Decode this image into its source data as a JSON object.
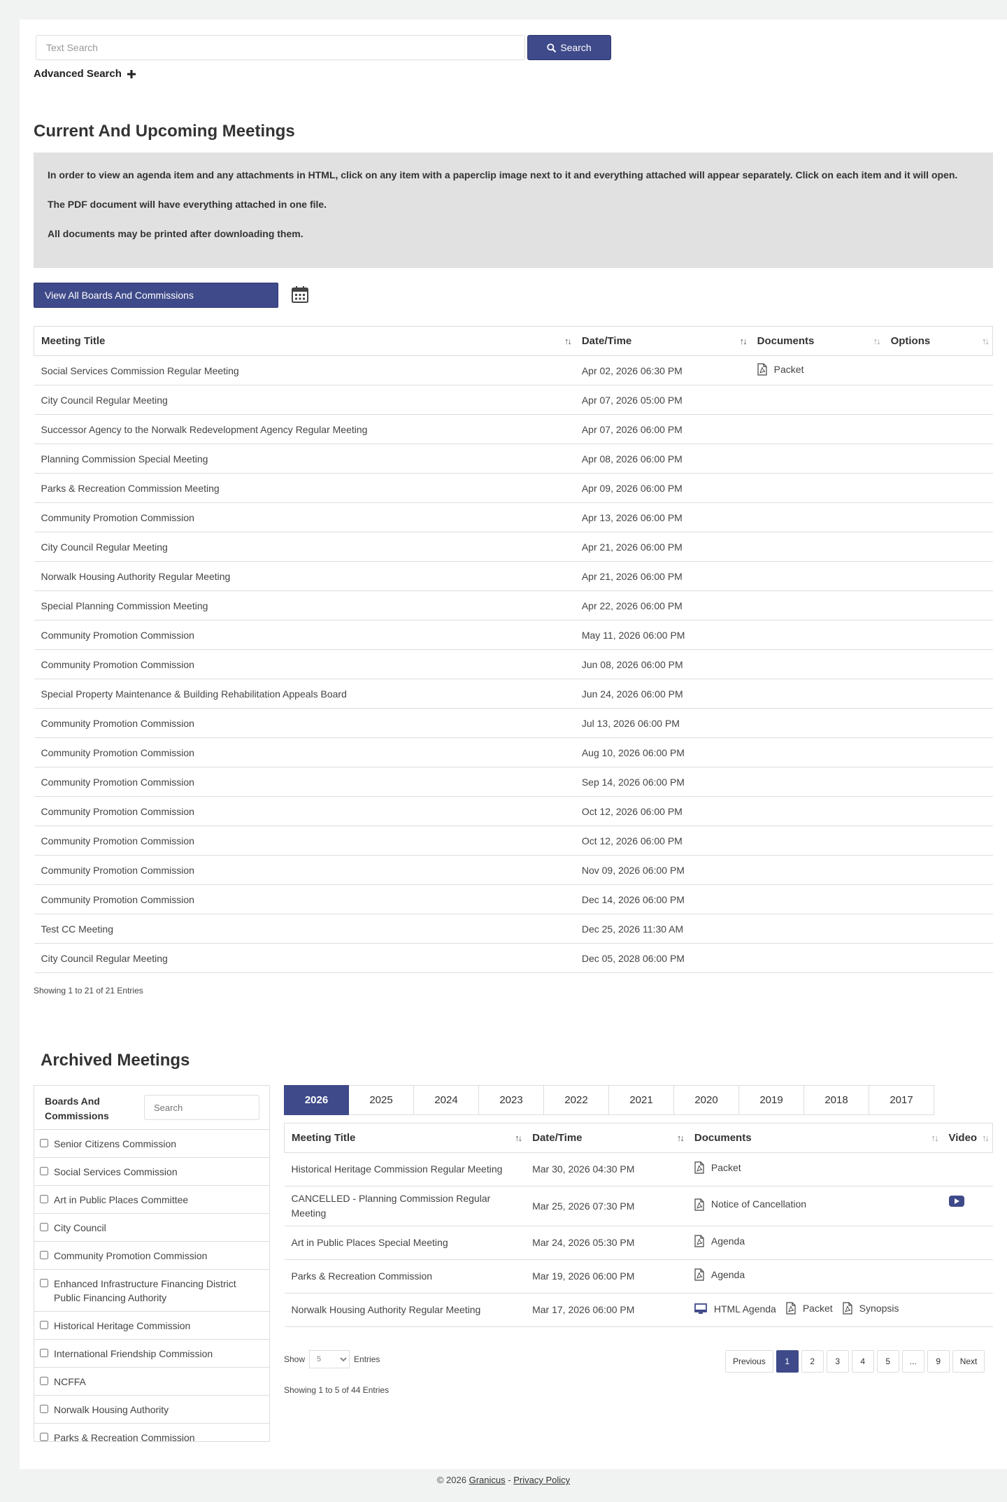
{
  "search": {
    "placeholder": "Text Search",
    "button_label": "Search"
  },
  "advanced_search_label": "Advanced Search",
  "upcoming": {
    "title": "Current And Upcoming Meetings",
    "notice": [
      "In order to view an agenda item and any attachments in HTML, click on any item with a paperclip image next to it and everything attached will appear separately.  Click on each item and it will open.",
      "The PDF document will have everything attached in one file.",
      "All documents may be printed after downloading them."
    ],
    "boards_button": "View All Boards And Commissions",
    "columns": [
      "Meeting Title",
      "Date/Time",
      "Documents",
      "Options"
    ],
    "rows": [
      {
        "title": "Social Services Commission Regular Meeting",
        "date": "Apr 02, 2026 06:30 PM",
        "doc": "Packet"
      },
      {
        "title": "City Council Regular Meeting",
        "date": "Apr 07, 2026 05:00 PM",
        "doc": ""
      },
      {
        "title": "Successor Agency to the Norwalk Redevelopment Agency Regular Meeting",
        "date": "Apr 07, 2026 06:00 PM",
        "doc": ""
      },
      {
        "title": "Planning Commission Special Meeting",
        "date": "Apr 08, 2026 06:00 PM",
        "doc": ""
      },
      {
        "title": "Parks & Recreation Commission Meeting",
        "date": "Apr 09, 2026 06:00 PM",
        "doc": ""
      },
      {
        "title": "Community Promotion Commission",
        "date": "Apr 13, 2026 06:00 PM",
        "doc": ""
      },
      {
        "title": "City Council Regular Meeting",
        "date": "Apr 21, 2026 06:00 PM",
        "doc": ""
      },
      {
        "title": "Norwalk Housing Authority Regular Meeting",
        "date": "Apr 21, 2026 06:00 PM",
        "doc": ""
      },
      {
        "title": "Special Planning Commission Meeting",
        "date": "Apr 22, 2026 06:00 PM",
        "doc": ""
      },
      {
        "title": "Community Promotion Commission",
        "date": "May 11, 2026 06:00 PM",
        "doc": ""
      },
      {
        "title": "Community Promotion Commission",
        "date": "Jun 08, 2026 06:00 PM",
        "doc": ""
      },
      {
        "title": "Special Property Maintenance & Building Rehabilitation Appeals Board",
        "date": "Jun 24, 2026 06:00 PM",
        "doc": ""
      },
      {
        "title": "Community Promotion Commission",
        "date": "Jul 13, 2026 06:00 PM",
        "doc": ""
      },
      {
        "title": "Community Promotion Commission",
        "date": "Aug 10, 2026 06:00 PM",
        "doc": ""
      },
      {
        "title": "Community Promotion Commission",
        "date": "Sep 14, 2026 06:00 PM",
        "doc": ""
      },
      {
        "title": "Community Promotion Commission",
        "date": "Oct 12, 2026 06:00 PM",
        "doc": ""
      },
      {
        "title": "Community Promotion Commission",
        "date": "Oct 12, 2026 06:00 PM",
        "doc": ""
      },
      {
        "title": "Community Promotion Commission",
        "date": "Nov 09, 2026 06:00 PM",
        "doc": ""
      },
      {
        "title": "Community Promotion Commission",
        "date": "Dec 14, 2026 06:00 PM",
        "doc": ""
      },
      {
        "title": "Test CC Meeting",
        "date": "Dec 25, 2026 11:30 AM",
        "doc": ""
      },
      {
        "title": "City Council Regular Meeting",
        "date": "Dec 05, 2028 06:00 PM",
        "doc": ""
      }
    ],
    "showing": "Showing 1 to 21 of 21 Entries"
  },
  "archived": {
    "title": "Archived Meetings",
    "filter_label": "Boards And Commissions",
    "filter_placeholder": "Search",
    "boards": [
      "Senior Citizens Commission",
      "Social Services Commission",
      "Art in Public Places Committee",
      "City Council",
      "Community Promotion Commission",
      "Enhanced Infrastructure Financing District Public Financing Authority",
      "Historical Heritage Commission",
      "International Friendship Commission",
      "NCFFA",
      "Norwalk Housing Authority",
      "Parks & Recreation Commission"
    ],
    "years": [
      "2026",
      "2025",
      "2024",
      "2023",
      "2022",
      "2021",
      "2020",
      "2019",
      "2018",
      "2017"
    ],
    "active_year": "2026",
    "columns": [
      "Meeting Title",
      "Date/Time",
      "Documents",
      "Video"
    ],
    "rows": [
      {
        "title": "Historical Heritage Commission Regular Meeting",
        "date": "Mar 30, 2026 04:30 PM",
        "docs": [
          {
            "label": "Packet",
            "icon": "pdf-icon"
          }
        ],
        "video": false
      },
      {
        "title": "CANCELLED - Planning Commission Regular Meeting",
        "date": "Mar 25, 2026 07:30 PM",
        "docs": [
          {
            "label": "Notice of Cancellation",
            "icon": "pdf-icon"
          }
        ],
        "video": true
      },
      {
        "title": "Art in Public Places Special Meeting",
        "date": "Mar 24, 2026 05:30 PM",
        "docs": [
          {
            "label": "Agenda",
            "icon": "pdf-icon"
          }
        ],
        "video": false
      },
      {
        "title": "Parks & Recreation Commission",
        "date": "Mar 19, 2026 06:00 PM",
        "docs": [
          {
            "label": "Agenda",
            "icon": "pdf-icon"
          }
        ],
        "video": false
      },
      {
        "title": "Norwalk Housing Authority Regular Meeting",
        "date": "Mar 17, 2026 06:00 PM",
        "docs": [
          {
            "label": "HTML Agenda",
            "icon": "monitor-icon"
          },
          {
            "label": "Packet",
            "icon": "pdf-icon"
          },
          {
            "label": "Synopsis",
            "icon": "pdf-icon"
          }
        ],
        "video": false
      }
    ],
    "show_label": "Show",
    "show_value": "5",
    "entries_label": "Entries",
    "pagination": [
      "Previous",
      "1",
      "2",
      "3",
      "4",
      "5",
      "...",
      "9",
      "Next"
    ],
    "active_page": "1",
    "showing": "Showing 1 to 5 of 44 Entries"
  },
  "footer": {
    "copyright": "© 2026",
    "company": "Granicus",
    "separator": "-",
    "privacy": "Privacy Policy"
  },
  "colors": {
    "accent": "#3f4a8a",
    "notice_bg": "#e1e1e1"
  }
}
